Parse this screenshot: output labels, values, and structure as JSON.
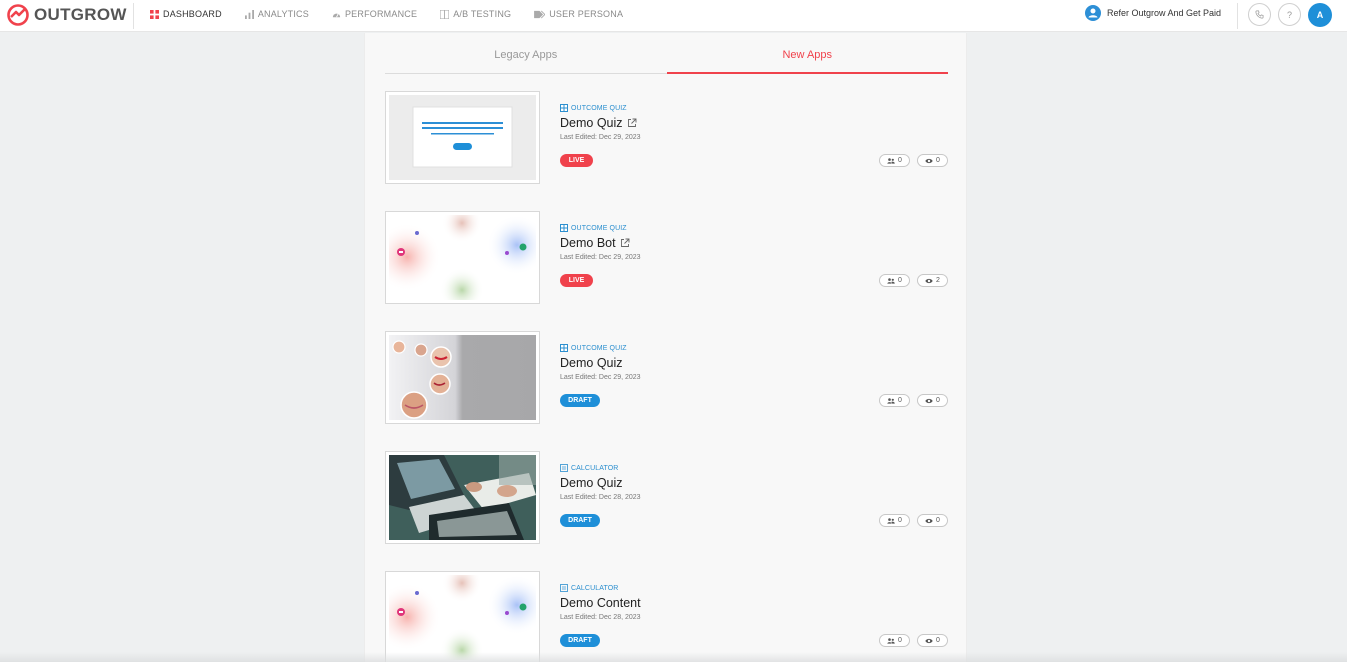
{
  "brand": {
    "name": "OUTGROW",
    "accent": "#f0424c"
  },
  "nav": [
    {
      "label": "DASHBOARD",
      "icon": "grid-icon",
      "active": true
    },
    {
      "label": "ANALYTICS",
      "icon": "bar-chart-icon",
      "active": false
    },
    {
      "label": "PERFORMANCE",
      "icon": "gauge-icon",
      "active": false
    },
    {
      "label": "A/B TESTING",
      "icon": "ab-icon",
      "active": false
    },
    {
      "label": "USER PERSONA",
      "icon": "tags-icon",
      "active": false
    }
  ],
  "header_right": {
    "refer_label": "Refer Outgrow And Get Paid",
    "help_label": "?",
    "avatar_initial": "A"
  },
  "tabs": [
    {
      "label": "Legacy Apps",
      "active": false
    },
    {
      "label": "New Apps",
      "active": true
    }
  ],
  "apps": [
    {
      "type": "OUTCOME QUIZ",
      "name": "Demo Quiz",
      "external_link": true,
      "date": "Last Edited: Dec 29, 2023",
      "status": "LIVE",
      "leads": "0",
      "views": "0",
      "thumb": "quiz-card"
    },
    {
      "type": "OUTCOME QUIZ",
      "name": "Demo Bot",
      "external_link": true,
      "date": "Last Edited: Dec 29, 2023",
      "status": "LIVE",
      "leads": "0",
      "views": "2",
      "thumb": "chatbot"
    },
    {
      "type": "OUTCOME QUIZ",
      "name": "Demo Quiz",
      "external_link": false,
      "date": "Last Edited: Dec 29, 2023",
      "status": "DRAFT",
      "leads": "0",
      "views": "0",
      "thumb": "faces"
    },
    {
      "type": "CALCULATOR",
      "name": "Demo Quiz",
      "external_link": false,
      "date": "Last Edited: Dec 28, 2023",
      "status": "DRAFT",
      "leads": "0",
      "views": "0",
      "thumb": "laptops"
    },
    {
      "type": "CALCULATOR",
      "name": "Demo Content",
      "external_link": false,
      "date": "Last Edited: Dec 28, 2023",
      "status": "DRAFT",
      "leads": "0",
      "views": "0",
      "thumb": "chatbot"
    }
  ]
}
